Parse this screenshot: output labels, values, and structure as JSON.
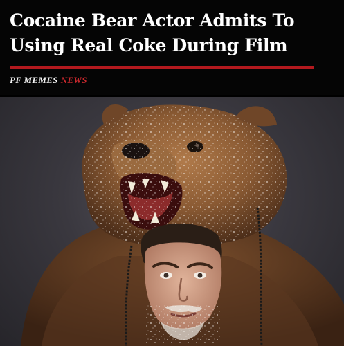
{
  "headline": "Cocaine Bear Actor Admits To Using Real Coke During Film",
  "byline": {
    "brand": "PF MEMES",
    "section": "NEWS"
  },
  "colors": {
    "accent_red": "#b3191e",
    "news_red": "#c8282d",
    "header_bg": "#050505"
  },
  "photo": {
    "subject": "man wearing a bear pelt headdress dusted with white powder"
  }
}
